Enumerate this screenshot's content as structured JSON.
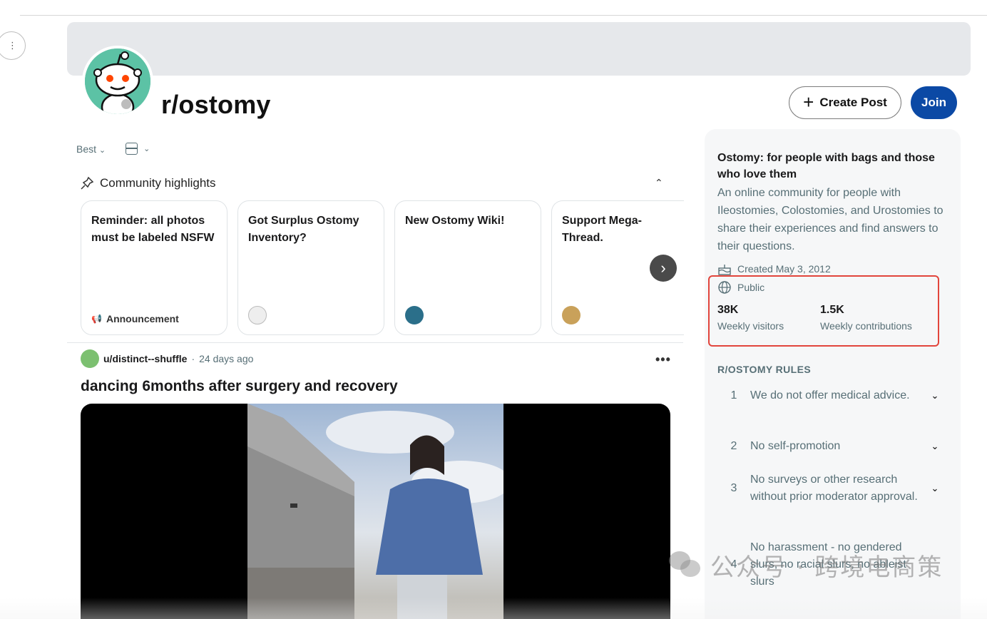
{
  "subreddit": {
    "name": "r/ostomy",
    "create_post_label": "Create Post",
    "join_label": "Join"
  },
  "feed_controls": {
    "sort_label": "Best"
  },
  "highlights": {
    "heading": "Community highlights",
    "cards": [
      {
        "title": "Reminder: all photos must be labeled NSFW",
        "footer": "Announcement"
      },
      {
        "title": "Got Surplus Ostomy Inventory?",
        "footer": ""
      },
      {
        "title": "New Ostomy Wiki!",
        "footer": ""
      },
      {
        "title": "Support Mega-Thread.",
        "footer": ""
      }
    ]
  },
  "post": {
    "author": "u/distinct--shuffle",
    "age": "24 days ago",
    "title": "dancing 6months after surgery and recovery"
  },
  "sidebar": {
    "title": "Ostomy: for people with bags and those who love them",
    "description": "An online community for people with Ileostomies, Colostomies, and Urostomies to share their experiences and find answers to their questions.",
    "created": "Created May 3, 2012",
    "visibility": "Public",
    "stats": [
      {
        "value": "38K",
        "label": "Weekly visitors"
      },
      {
        "value": "1.5K",
        "label": "Weekly contributions"
      }
    ],
    "rules_heading": "R/OSTOMY RULES",
    "rules": [
      {
        "num": "1",
        "text": "We do not offer medical advice."
      },
      {
        "num": "2",
        "text": "No self-promotion"
      },
      {
        "num": "3",
        "text": "No surveys or other research without prior moderator approval."
      },
      {
        "num": "4",
        "text": "No harassment - no gendered slurs, no racial slurs, no ableist slurs"
      }
    ]
  },
  "watermark": {
    "text": "公众号 · 跨境电商策"
  },
  "colors": {
    "join_button": "#0b49a5",
    "avatar_bg": "#5cc2a5",
    "highlight_box": "#e2453c"
  }
}
